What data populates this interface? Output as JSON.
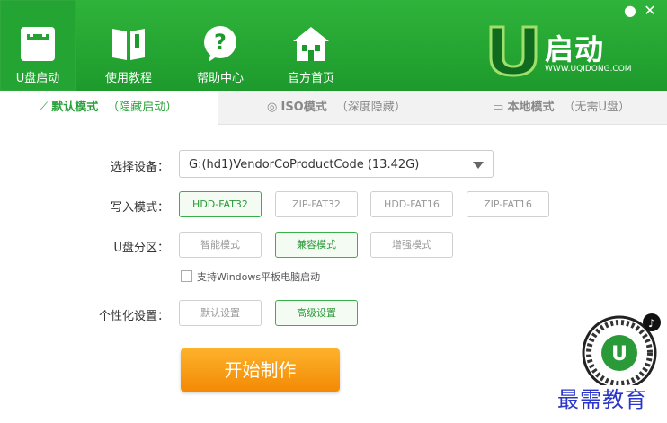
{
  "window": {
    "minimize_label": "",
    "close_label": "✕"
  },
  "nav": {
    "items": [
      {
        "label": "U盘启动"
      },
      {
        "label": "使用教程"
      },
      {
        "label": "帮助中心"
      },
      {
        "label": "官方首页"
      }
    ]
  },
  "logo": {
    "text": "启动",
    "url": "WWW.UQIDONG.COM"
  },
  "tabs": [
    {
      "label": "默认模式",
      "sub": "（隐藏启动）"
    },
    {
      "label": "ISO模式",
      "sub": "（深度隐藏）"
    },
    {
      "label": "本地模式",
      "sub": "（无需U盘）"
    }
  ],
  "device": {
    "label": "选择设备：",
    "value": "G:(hd1)VendorCoProductCode (13.42G)"
  },
  "write_mode": {
    "label": "写入模式：",
    "options": [
      "HDD-FAT32",
      "ZIP-FAT32",
      "HDD-FAT16",
      "ZIP-FAT16"
    ],
    "selected": "HDD-FAT32"
  },
  "partition": {
    "label": "U盘分区：",
    "options": [
      "智能模式",
      "兼容模式",
      "增强模式"
    ],
    "selected": "兼容模式"
  },
  "tablet": {
    "label": "支持Windows平板电脑启动"
  },
  "personal": {
    "label": "个性化设置：",
    "options": [
      "默认设置",
      "高级设置"
    ],
    "selected": "高级设置"
  },
  "start_label": "开始制作",
  "watermark": "最需教育",
  "colors": {
    "accent": "#2aa13a",
    "button": "#f59a10"
  }
}
